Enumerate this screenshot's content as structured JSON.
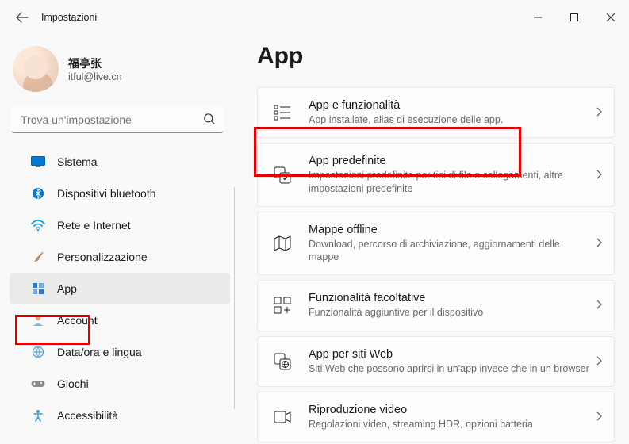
{
  "window": {
    "title": "Impostazioni"
  },
  "user": {
    "display_name": "福亭张",
    "email": "itful@live.cn"
  },
  "search": {
    "placeholder": "Trova un'impostazione"
  },
  "sidebar": {
    "items": [
      {
        "label": "Sistema",
        "icon": "monitor"
      },
      {
        "label": "Dispositivi bluetooth",
        "icon": "bluetooth"
      },
      {
        "label": "Rete e Internet",
        "icon": "wifi"
      },
      {
        "label": "Personalizzazione",
        "icon": "brush"
      },
      {
        "label": "App",
        "icon": "apps"
      },
      {
        "label": "Account",
        "icon": "person"
      },
      {
        "label": "Data/ora e lingua",
        "icon": "globe"
      },
      {
        "label": "Giochi",
        "icon": "gamepad"
      },
      {
        "label": "Accessibilità",
        "icon": "accessibility"
      }
    ],
    "selected_index": 4
  },
  "main": {
    "heading": "App",
    "cards": [
      {
        "title": "App e funzionalità",
        "subtitle": "App installate, alias di esecuzione delle app.",
        "icon": "list"
      },
      {
        "title": "App predefinite",
        "subtitle": "Impostazioni predefinite per tipi di file e collegamenti, altre impostazioni predefinite",
        "icon": "defaults"
      },
      {
        "title": "Mappe offline",
        "subtitle": "Download, percorso di archiviazione, aggiornamenti delle mappe",
        "icon": "map"
      },
      {
        "title": "Funzionalità facoltative",
        "subtitle": "Funzionalità aggiuntive per il dispositivo",
        "icon": "addfeat"
      },
      {
        "title": "App per siti Web",
        "subtitle": "Siti Web che possono aprirsi in un'app invece che in un browser",
        "icon": "webapps"
      },
      {
        "title": "Riproduzione video",
        "subtitle": "Regolazioni video, streaming HDR, opzioni batteria",
        "icon": "video"
      }
    ]
  }
}
